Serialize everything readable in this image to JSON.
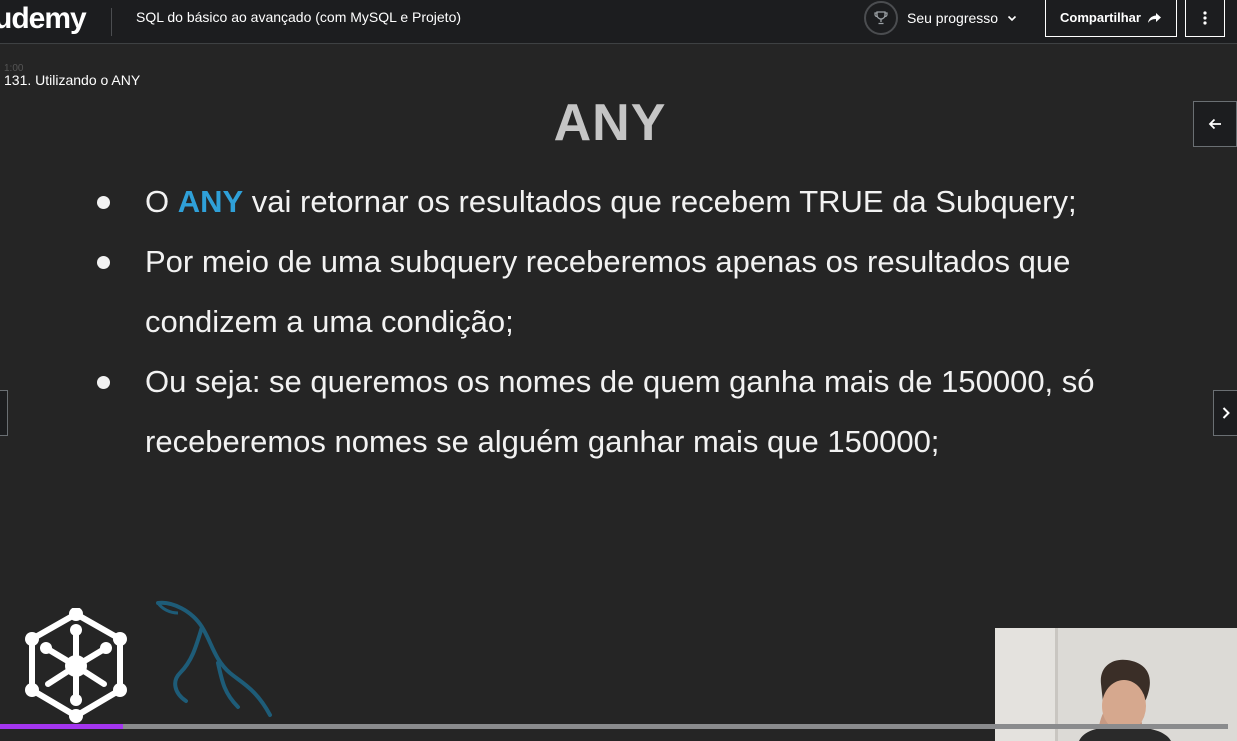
{
  "header": {
    "logo_text": "udemy",
    "course_title": "SQL do básico ao avançado (com MySQL e Projeto)",
    "progress_label": "Seu progresso",
    "share_label": "Compartilhar"
  },
  "player": {
    "time_ghost": "1:00",
    "lecture_title": "131. Utilizando o ANY",
    "playback_progress_fraction": 0.1
  },
  "slide": {
    "title": "ANY",
    "bullets": [
      {
        "before": "O ",
        "highlight": "ANY",
        "after": " vai retornar os resultados que recebem TRUE da Subquery;"
      },
      {
        "before": "Por meio de uma subquery receberemos apenas os resultados que condizem a uma condição;",
        "highlight": "",
        "after": ""
      },
      {
        "before": "Ou seja: se queremos os nomes de quem ganha mais de 150000, só receberemos nomes se alguém ganhar mais que 150000;",
        "highlight": "",
        "after": ""
      }
    ],
    "highlight_color": "#2fa0d8"
  },
  "colors": {
    "accent": "#a435f0",
    "header_bg": "#1c1d1f",
    "slide_bg": "#252525"
  },
  "icons": {
    "progress": "trophy-icon",
    "dropdown": "chevron-down-icon",
    "share": "share-arrow-icon",
    "more": "more-vertical-icon",
    "collapse": "arrow-left-icon",
    "next": "chevron-right-icon"
  }
}
